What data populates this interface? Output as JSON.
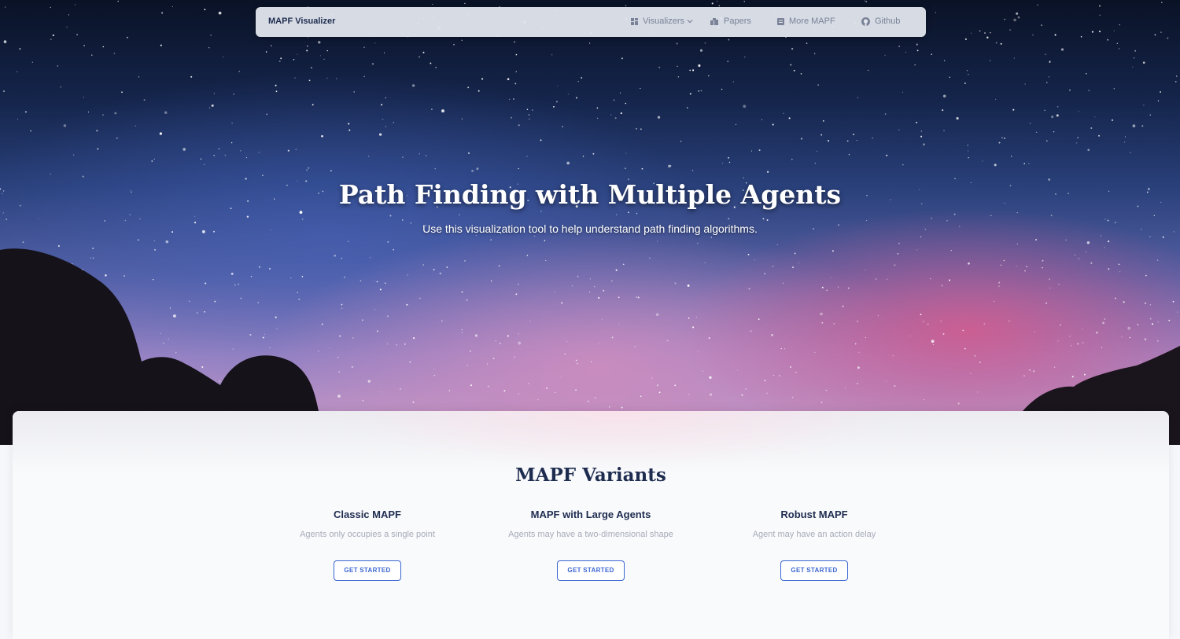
{
  "navbar": {
    "brand": "MAPF Visualizer",
    "items": [
      {
        "label": "Visualizers",
        "icon": "grid-icon"
      },
      {
        "label": "Papers",
        "icon": "books-icon"
      },
      {
        "label": "More MAPF",
        "icon": "document-icon"
      },
      {
        "label": "Github",
        "icon": "github-icon"
      }
    ]
  },
  "hero": {
    "title": "Path Finding with Multiple Agents",
    "subtitle": "Use this visualization tool to help understand path finding algorithms."
  },
  "variants_section": {
    "title": "MAPF Variants",
    "cards": [
      {
        "title": "Classic MAPF",
        "description": "Agents only occupies a single point",
        "button": "GET STARTED"
      },
      {
        "title": "MAPF with Large Agents",
        "description": "Agents may have a two-dimensional shape",
        "button": "GET STARTED"
      },
      {
        "title": "Robust MAPF",
        "description": "Agent may have an action delay",
        "button": "GET STARTED"
      }
    ]
  },
  "colors": {
    "accent": "#3b66d1",
    "heading": "#1e2c4f"
  }
}
